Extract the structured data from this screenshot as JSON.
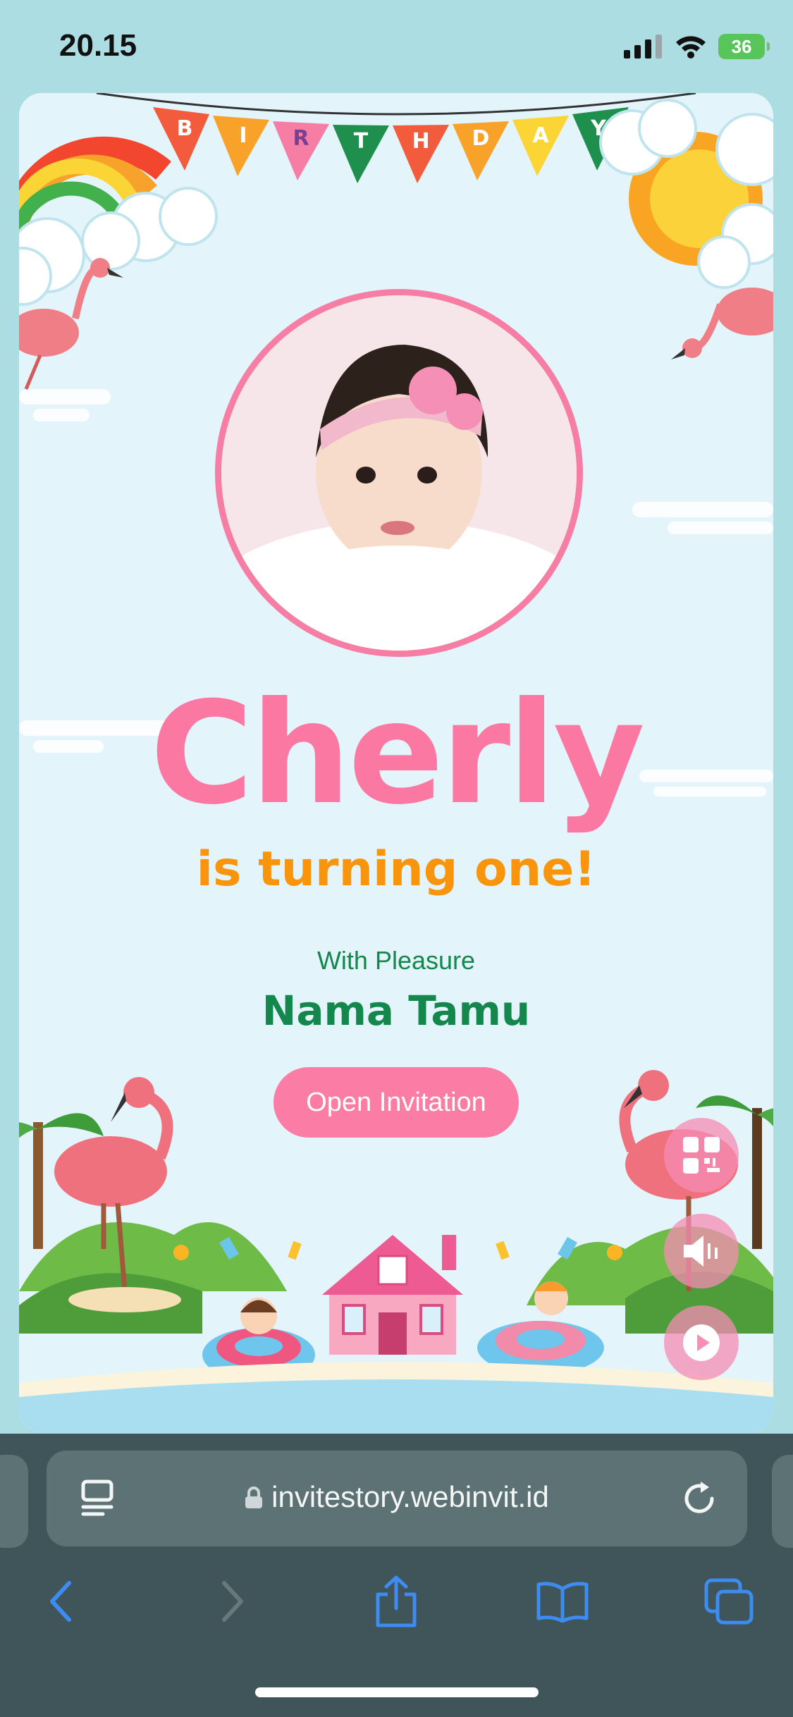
{
  "status_bar": {
    "time": "20.15",
    "battery": "36"
  },
  "banner": {
    "letters": [
      "B",
      "I",
      "R",
      "T",
      "H",
      "D",
      "A",
      "Y"
    ]
  },
  "invitation": {
    "name": "Cherly",
    "subtitle": "is turning one!",
    "greeting": "With Pleasure",
    "guest_name": "Nama Tamu",
    "open_button": "Open Invitation"
  },
  "floating_buttons": [
    "qr-code-icon",
    "speaker-muted-icon",
    "play-icon"
  ],
  "browser": {
    "url": "invitestory.webinvit.id"
  },
  "toolbar": [
    "back-icon",
    "forward-icon",
    "share-icon",
    "bookmarks-icon",
    "tabs-icon"
  ],
  "colors": {
    "accent_pink": "#fb78a2",
    "accent_orange": "#f8950c",
    "accent_green": "#14884c",
    "ios_blue": "#3d8cf2"
  }
}
